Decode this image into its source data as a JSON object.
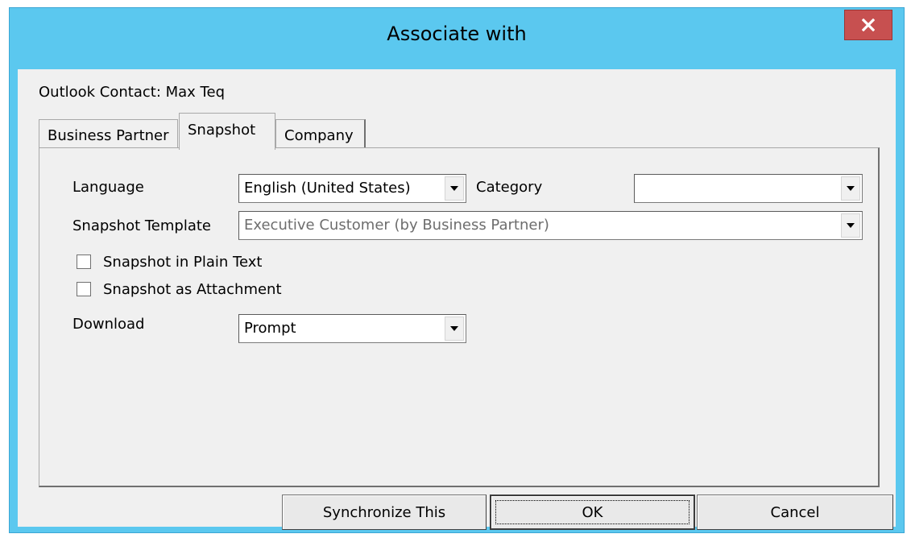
{
  "window": {
    "title": "Associate with",
    "close_icon": "close-icon"
  },
  "contact": {
    "label": "Outlook Contact: Max Teq"
  },
  "tabs": [
    {
      "label": "Business Partner",
      "active": false
    },
    {
      "label": "Snapshot",
      "active": true
    },
    {
      "label": "Company",
      "active": false
    }
  ],
  "form": {
    "language_label": "Language",
    "language_value": "English (United States)",
    "category_label": "Category",
    "category_value": "",
    "template_label": "Snapshot Template",
    "template_value": "Executive Customer (by Business Partner)",
    "plain_text_label": "Snapshot in Plain Text",
    "plain_text_checked": false,
    "attachment_label": "Snapshot as Attachment",
    "attachment_checked": false,
    "download_label": "Download",
    "download_value": "Prompt"
  },
  "buttons": {
    "sync": "Synchronize This",
    "ok": "OK",
    "cancel": "Cancel"
  },
  "colors": {
    "titlebar": "#5bc8ef",
    "close": "#c75050",
    "client": "#f0f0f0"
  }
}
